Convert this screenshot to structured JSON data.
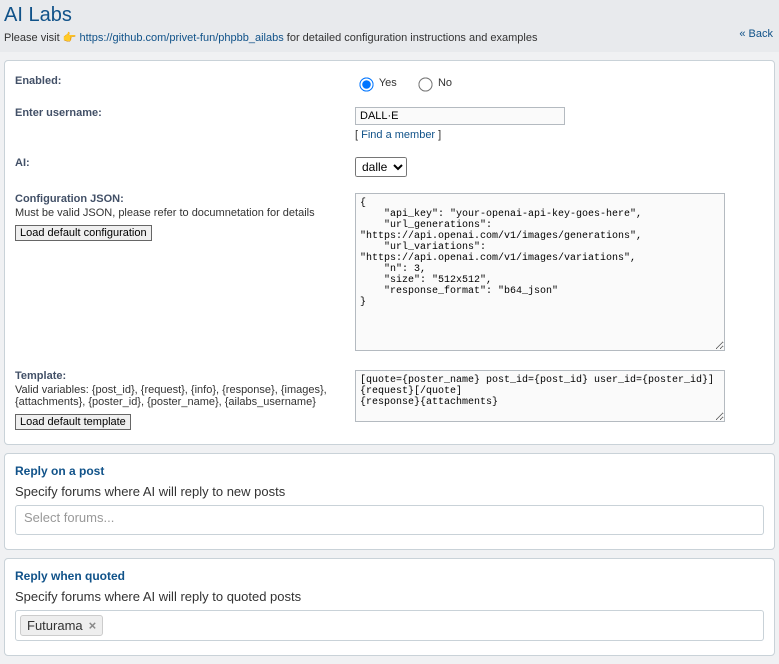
{
  "header": {
    "title": "AI Labs",
    "prefix": "Please visit ",
    "emoji": "👉 ",
    "repo_url": "https://github.com/privet-fun/phpbb_ailabs",
    "suffix": " for detailed configuration instructions and examples",
    "back": "« Back"
  },
  "form": {
    "enabled_label": "Enabled:",
    "yes": "Yes",
    "no": "No",
    "username_label": "Enter username:",
    "username_value": "DALL·E",
    "find_member": "Find a member",
    "ai_label": "AI:",
    "ai_options": [
      "dalle"
    ],
    "ai_selected": "dalle",
    "config_label": "Configuration JSON:",
    "config_hint": "Must be valid JSON, please refer to documnetation for details",
    "config_btn": "Load default configuration",
    "config_value": "{\n    \"api_key\": \"your-openai-api-key-goes-here\",\n    \"url_generations\": \"https://api.openai.com/v1/images/generations\",\n    \"url_variations\": \"https://api.openai.com/v1/images/variations\",\n    \"n\": 3,\n    \"size\": \"512x512\",\n    \"response_format\": \"b64_json\"\n}",
    "template_label": "Template:",
    "template_hint": "Valid variables: {post_id}, {request}, {info}, {response}, {images}, {attachments}, {poster_id}, {poster_name}, {ailabs_username}",
    "template_btn": "Load default template",
    "template_value": "[quote={poster_name} post_id={post_id} user_id={poster_id}]{request}[/quote]\n{response}{attachments}"
  },
  "reply_post": {
    "legend": "Reply on a post",
    "desc": "Specify forums where AI will reply to new posts",
    "placeholder": "Select forums..."
  },
  "reply_quoted": {
    "legend": "Reply when quoted",
    "desc": "Specify forums where AI will reply to quoted posts",
    "tag": "Futurama",
    "remove": "×"
  }
}
